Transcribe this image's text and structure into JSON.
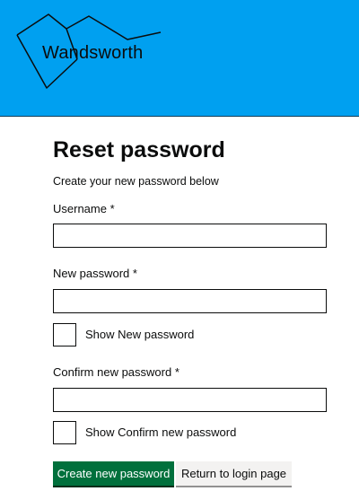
{
  "header": {
    "logo_text": "Wandsworth",
    "background_color": "#00a0f0"
  },
  "form": {
    "title": "Reset password",
    "intro": "Create your new password below",
    "username": {
      "label": "Username *",
      "value": ""
    },
    "new_password": {
      "label": "New password *",
      "value": ""
    },
    "show_new_password": {
      "label": "Show New password",
      "checked": false
    },
    "confirm_password": {
      "label": "Confirm new password *",
      "value": ""
    },
    "show_confirm_password": {
      "label": "Show Confirm new password",
      "checked": false
    }
  },
  "actions": {
    "primary_label": "Create new password",
    "primary_color": "#00703c",
    "secondary_label": "Return to login page"
  }
}
